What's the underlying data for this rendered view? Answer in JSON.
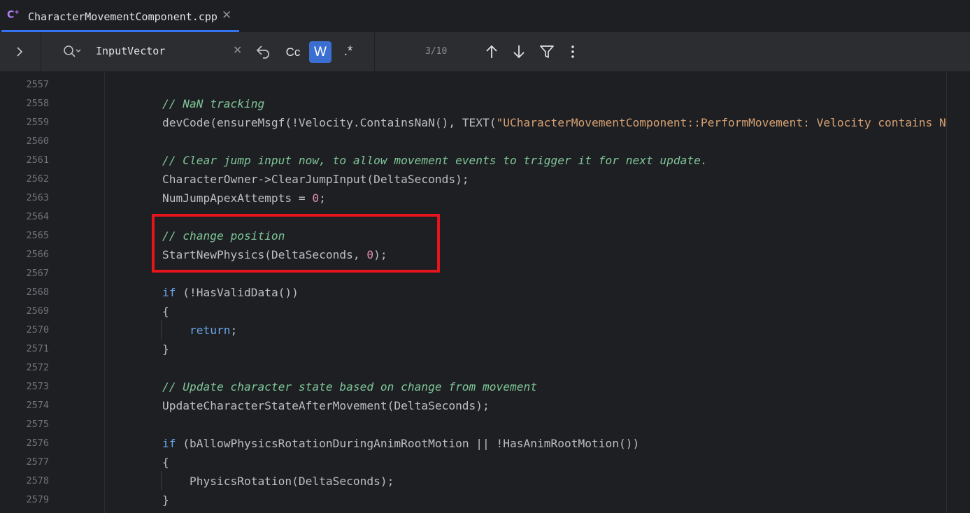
{
  "tab": {
    "icon": "C",
    "icon_suffix": "+",
    "title": "CharacterMovementComponent.cpp",
    "close": "✕"
  },
  "search": {
    "query": "InputVector",
    "clear": "✕",
    "match_case_label": "Cc",
    "words_label": "W",
    "regex_label": ".*",
    "match_count": "3/10",
    "words_active": true
  },
  "icons": {
    "expand": "chevron-right-icon",
    "search": "search-icon",
    "clear": "close-icon",
    "newline": "newline-icon",
    "prev": "arrow-up-icon",
    "next": "arrow-down-icon",
    "filter": "filter-icon",
    "more": "more-vertical-icon"
  },
  "colors": {
    "accent": "#3574f0",
    "words_active_bg": "#3a6fd1",
    "highlight_box": "#e6141b",
    "comment": "#7ec699",
    "keyword": "#6aa4e8",
    "string": "#d6a173",
    "number": "#e08eb4"
  },
  "editor": {
    "lines": [
      {
        "num": "2557",
        "tokens": []
      },
      {
        "num": "2558",
        "tokens": [
          {
            "t": "// NaN tracking",
            "k": "comment"
          }
        ]
      },
      {
        "num": "2559",
        "tokens": [
          {
            "t": "devCode(ensureMsgf(!Velocity.ContainsNaN(), TEXT(",
            "k": "plain"
          },
          {
            "t": "\"UCharacterMovementComponent::PerformMovement: Velocity contains NaN",
            "k": "string"
          }
        ]
      },
      {
        "num": "2560",
        "tokens": []
      },
      {
        "num": "2561",
        "tokens": [
          {
            "t": "// Clear jump input now, to allow movement events to trigger it for next update.",
            "k": "comment"
          }
        ]
      },
      {
        "num": "2562",
        "tokens": [
          {
            "t": "CharacterOwner->ClearJumpInput(DeltaSeconds);",
            "k": "plain"
          }
        ]
      },
      {
        "num": "2563",
        "tokens": [
          {
            "t": "NumJumpApexAttempts = ",
            "k": "plain"
          },
          {
            "t": "0",
            "k": "number"
          },
          {
            "t": ";",
            "k": "plain"
          }
        ]
      },
      {
        "num": "2564",
        "tokens": []
      },
      {
        "num": "2565",
        "tokens": [
          {
            "t": "// change position",
            "k": "comment"
          }
        ]
      },
      {
        "num": "2566",
        "tokens": [
          {
            "t": "StartNewPhysics(DeltaSeconds, ",
            "k": "plain"
          },
          {
            "t": "0",
            "k": "number"
          },
          {
            "t": ");",
            "k": "plain"
          }
        ]
      },
      {
        "num": "2567",
        "tokens": []
      },
      {
        "num": "2568",
        "tokens": [
          {
            "t": "if",
            "k": "keyword"
          },
          {
            "t": " (!HasValidData())",
            "k": "plain"
          }
        ]
      },
      {
        "num": "2569",
        "tokens": [
          {
            "t": "{",
            "k": "plain"
          }
        ]
      },
      {
        "num": "2570",
        "tokens": [
          {
            "t": "    ",
            "k": "plain"
          },
          {
            "t": "return",
            "k": "keyword"
          },
          {
            "t": ";",
            "k": "plain"
          }
        ]
      },
      {
        "num": "2571",
        "tokens": [
          {
            "t": "}",
            "k": "plain"
          }
        ]
      },
      {
        "num": "2572",
        "tokens": []
      },
      {
        "num": "2573",
        "tokens": [
          {
            "t": "// Update character state based on change from movement",
            "k": "comment"
          }
        ]
      },
      {
        "num": "2574",
        "tokens": [
          {
            "t": "UpdateCharacterStateAfterMovement(DeltaSeconds);",
            "k": "plain"
          }
        ]
      },
      {
        "num": "2575",
        "tokens": []
      },
      {
        "num": "2576",
        "tokens": [
          {
            "t": "if",
            "k": "keyword"
          },
          {
            "t": " (bAllowPhysicsRotationDuringAnimRootMotion || !HasAnimRootMotion())",
            "k": "plain"
          }
        ]
      },
      {
        "num": "2577",
        "tokens": [
          {
            "t": "{",
            "k": "plain"
          }
        ]
      },
      {
        "num": "2578",
        "tokens": [
          {
            "t": "    PhysicsRotation(DeltaSeconds);",
            "k": "plain"
          }
        ]
      },
      {
        "num": "2579",
        "tokens": [
          {
            "t": "}",
            "k": "plain"
          }
        ]
      }
    ]
  }
}
